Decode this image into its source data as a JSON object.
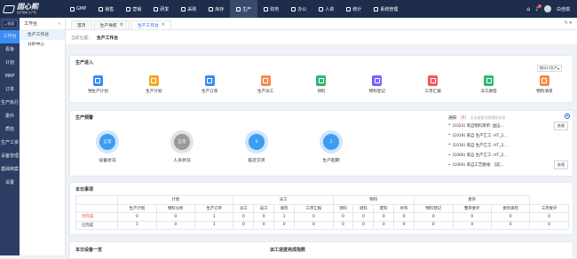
{
  "app": {
    "brand": "固心熙",
    "brand_sub": "医疗器械·生产版"
  },
  "topnav": [
    {
      "label": "GMP",
      "icon": "gmp-icon"
    },
    {
      "label": "销售",
      "icon": "cart-icon"
    },
    {
      "label": "营销",
      "icon": "megaphone-icon"
    },
    {
      "label": "研发",
      "icon": "flask-icon"
    },
    {
      "label": "采购",
      "icon": "bag-icon"
    },
    {
      "label": "库存",
      "icon": "box-icon"
    },
    {
      "label": "生产",
      "icon": "factory-icon",
      "active": true
    },
    {
      "label": "财务",
      "icon": "coin-icon"
    },
    {
      "label": "办公",
      "icon": "cloud-icon"
    },
    {
      "label": "人资",
      "icon": "person-icon"
    },
    {
      "label": "统计",
      "icon": "chart-icon"
    },
    {
      "label": "系统管理",
      "icon": "gear-icon"
    }
  ],
  "user": {
    "name": "白佳琪",
    "badge": "3"
  },
  "sidebar": {
    "search_placeholder": "搜索",
    "items": [
      "工作台",
      "看板",
      "计划",
      "MRP",
      "订单",
      "生产执行",
      "委外",
      "质检",
      "生产工资",
      "设备管理",
      "基础档案",
      "设置"
    ]
  },
  "subsidebar": {
    "title": "工作台",
    "items": [
      "生产工作台",
      "分析中心"
    ]
  },
  "tabs": [
    "首页",
    "生产导航",
    "生产工作台"
  ],
  "breadcrumb": {
    "label": "当前位置：",
    "current": "生产工作台"
  },
  "entry": {
    "title": "生产进入",
    "select": "统计口生产",
    "items": [
      {
        "label": "预生产计划",
        "icon": "plan-icon",
        "color": "#3c8cf4"
      },
      {
        "label": "生产计划",
        "icon": "calendar-icon",
        "color": "#f5a623"
      },
      {
        "label": "生产订单",
        "icon": "clipboard-icon",
        "color": "#3c8cf4"
      },
      {
        "label": "生产派工",
        "icon": "dispatch-icon",
        "color": "#f28b4c"
      },
      {
        "label": "领料",
        "icon": "material-icon",
        "color": "#2eb872"
      },
      {
        "label": "物料登记",
        "icon": "register-icon",
        "color": "#7b61ff"
      },
      {
        "label": "工序汇报",
        "icon": "report-icon",
        "color": "#f05a5a"
      },
      {
        "label": "派工质检",
        "icon": "shield-check-icon",
        "color": "#2eb872"
      },
      {
        "label": "物料清单",
        "icon": "bom-icon",
        "color": "#f28b4c"
      }
    ]
  },
  "warning": {
    "title": "生产预警",
    "items": [
      {
        "label": "设备状况",
        "value": "正常",
        "color": "#3c9ef0",
        "ring": "#cfe5fb"
      },
      {
        "label": "人员状况",
        "value": "正常",
        "color": "#9a9a9a",
        "ring": "#e3e3e3"
      },
      {
        "label": "临近交货",
        "value": "0",
        "color": "#3c9ef0",
        "ring": "#cfe5fb"
      },
      {
        "label": "生产超期",
        "value": "2",
        "color": "#3c9ef0",
        "ring": "#cfe5fb"
      }
    ]
  },
  "notice": {
    "title": "通知",
    "count": "(6)",
    "hint": "点击查看详细通知消息",
    "button": "处理",
    "items": [
      "(1024) 来自物料清单: 血压...",
      "(1019) 来自 生产汇工: HT_2...",
      "(1016) 来自 生产汇工: HT_2...",
      "(1006) 来自 生产汇工: HT_2...",
      "(1004) 来自工艺路线: 【起..."
    ]
  },
  "today": {
    "title": "本日事项",
    "groups": [
      "计划",
      "派工",
      "物料",
      "委外"
    ],
    "columns": [
      "生产计划",
      "物料分析",
      "生产订单",
      "派工",
      "返工",
      "质检",
      "工序汇报",
      "领料",
      "退料",
      "废料",
      "补料",
      "物料登记",
      "整单委外",
      "委外质检",
      "工序委外"
    ],
    "rows": [
      {
        "label": "待完成",
        "values": [
          "0",
          "0",
          "1",
          "0",
          "0",
          "1",
          "0",
          "0",
          "0",
          "0",
          "0",
          "0",
          "0",
          "0",
          "0"
        ]
      },
      {
        "label": "已完成",
        "values": [
          "1",
          "0",
          "1",
          "0",
          "0",
          "0",
          "0",
          "0",
          "0",
          "0",
          "0",
          "0",
          "0",
          "0",
          "0"
        ]
      }
    ]
  },
  "bottom": {
    "left": "本日设备一览",
    "right": "派工进度完成指数"
  }
}
